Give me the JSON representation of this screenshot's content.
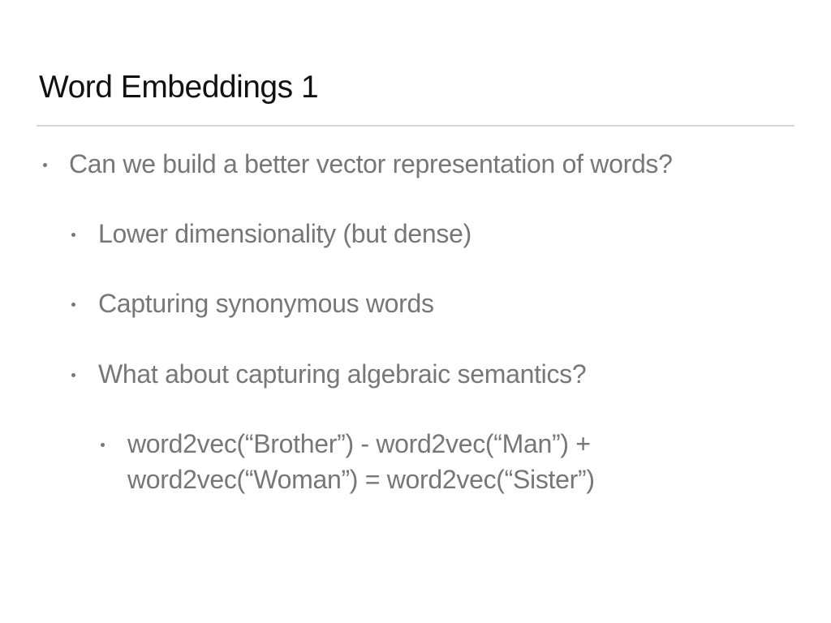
{
  "slide": {
    "title": "Word Embeddings 1",
    "bullets": [
      {
        "level": 1,
        "text": "Can we build a better vector representation of words?"
      },
      {
        "level": 2,
        "text": "Lower dimensionality (but dense)"
      },
      {
        "level": 2,
        "text": "Capturing synonymous words"
      },
      {
        "level": 2,
        "text": "What about capturing algebraic semantics?"
      },
      {
        "level": 3,
        "lines": [
          "word2vec(“Brother”) - word2vec(“Man”) +",
          "word2vec(“Woman”) = word2vec(“Sister”)"
        ]
      }
    ]
  },
  "colors": {
    "title": "#111111",
    "body_text": "#777777",
    "divider": "#d6d6d6",
    "background": "#ffffff"
  }
}
